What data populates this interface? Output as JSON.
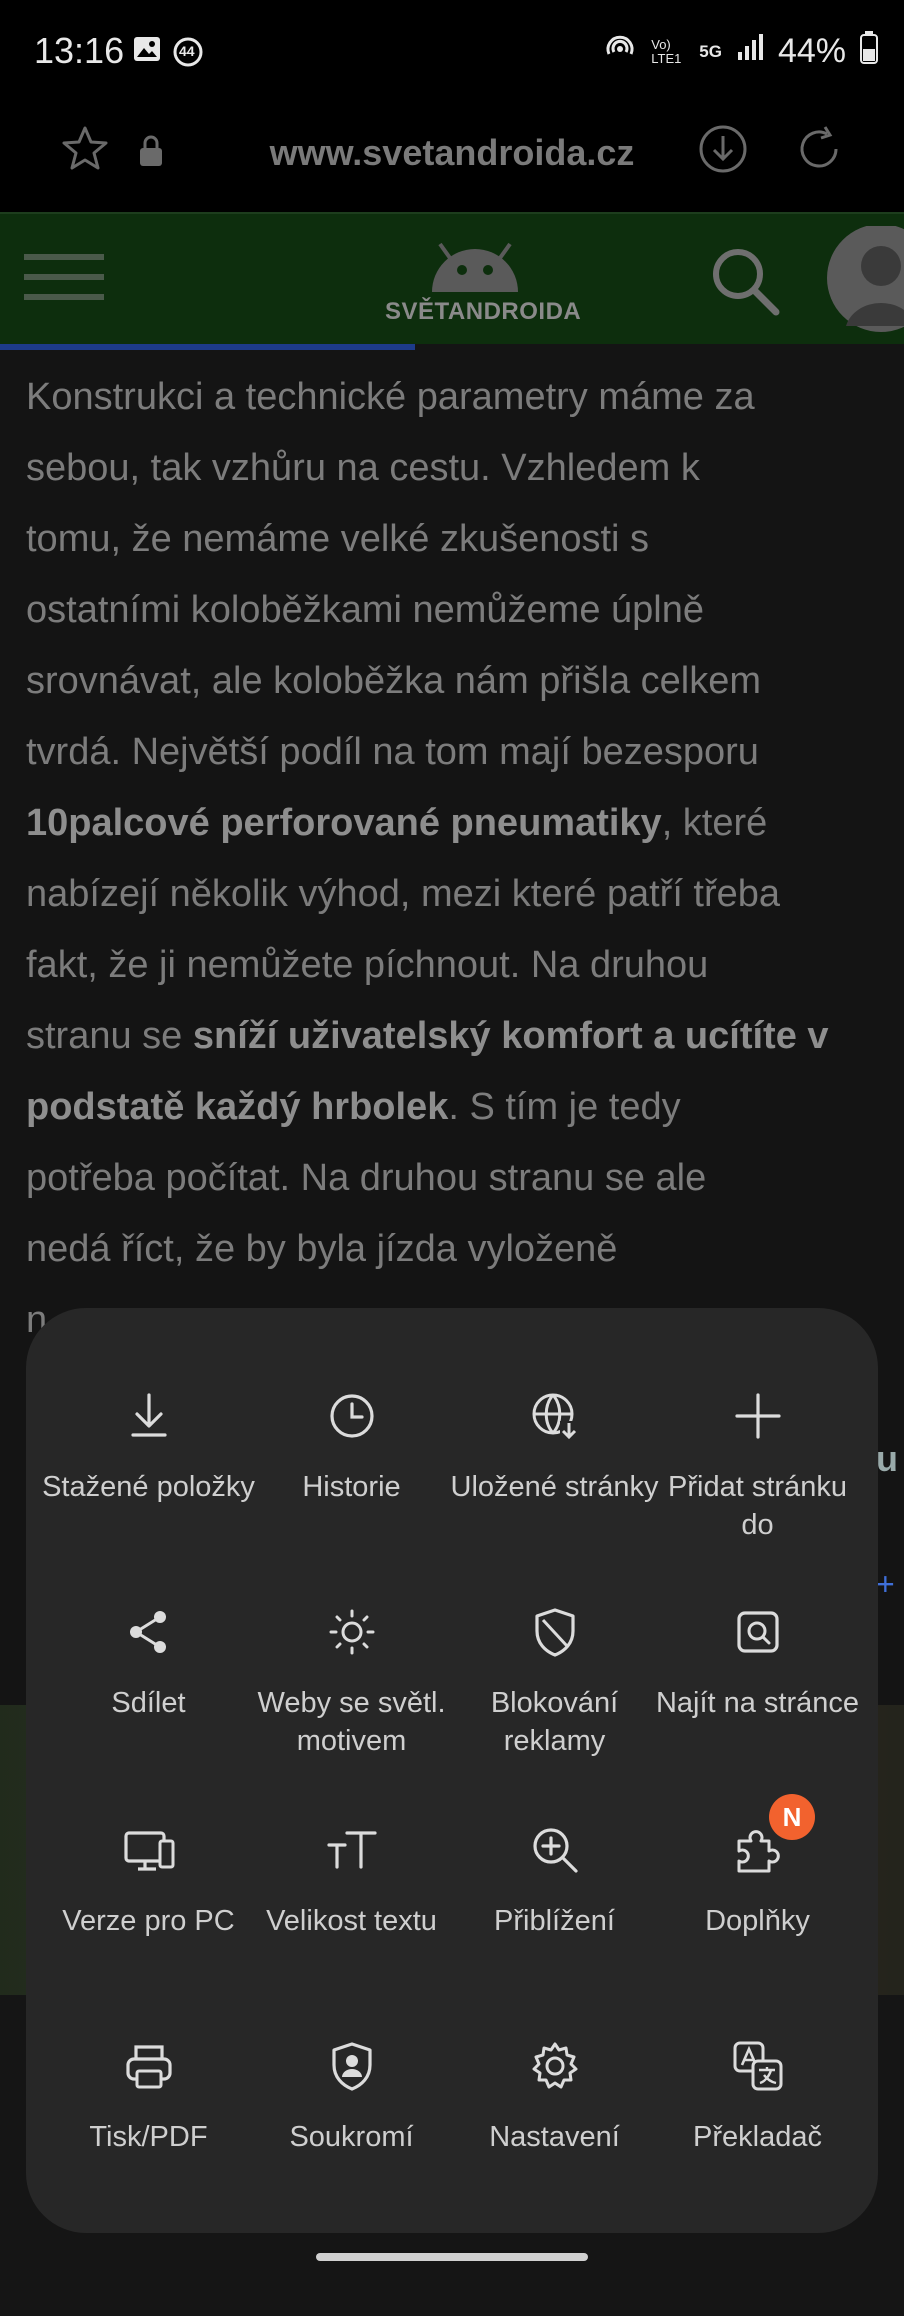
{
  "status_bar": {
    "time": "13:16",
    "notification_count": "44",
    "network": "5G",
    "carrier_label": "Vo) LTE1",
    "battery": "44%"
  },
  "browser": {
    "url": "www.svetandroida.cz"
  },
  "site": {
    "logo_text": "SVĚTANDROIDA"
  },
  "article": {
    "lines": [
      [
        {
          "t": "Konstrukci a technické parametry máme za",
          "b": false
        }
      ],
      [
        {
          "t": "sebou, tak vzhůru na cestu. Vzhledem k",
          "b": false
        }
      ],
      [
        {
          "t": "tomu, že nemáme velké zkušenosti s",
          "b": false
        }
      ],
      [
        {
          "t": "ostatními koloběžkami nemůžeme úplně",
          "b": false
        }
      ],
      [
        {
          "t": "srovnávat, ale koloběžka nám přišla celkem",
          "b": false
        }
      ],
      [
        {
          "t": "tvrdá. Největší podíl na tom mají bezesporu",
          "b": false
        }
      ],
      [
        {
          "t": "10palcové perforované pneumatiky",
          "b": true
        },
        {
          "t": ", které",
          "b": false
        }
      ],
      [
        {
          "t": "nabízejí několik výhod, mezi které patří třeba",
          "b": false
        }
      ],
      [
        {
          "t": "fakt, že ji nemůžete píchnout. Na druhou",
          "b": false
        }
      ],
      [
        {
          "t": "stranu se ",
          "b": false
        },
        {
          "t": "sníží uživatelský komfort a ucítíte v",
          "b": true
        }
      ],
      [
        {
          "t": "podstatě každý hrbolek",
          "b": true
        },
        {
          "t": ". S tím je tedy",
          "b": false
        }
      ],
      [
        {
          "t": "potřeba počítat. Na druhou stranu se ale",
          "b": false
        }
      ],
      [
        {
          "t": "nedá říct, že by byla jízda vyloženě",
          "b": false
        }
      ],
      [
        {
          "t": "n",
          "b": false
        }
      ]
    ],
    "peek_right": "u",
    "peek_plus": "+"
  },
  "menu": {
    "items": [
      {
        "label": "Stažené položky",
        "icon": "download-icon"
      },
      {
        "label": "Historie",
        "icon": "clock-icon"
      },
      {
        "label": "Uložené stránky",
        "icon": "saved-pages-icon"
      },
      {
        "label": "Přidat stránku do",
        "icon": "plus-icon"
      },
      {
        "label": "Sdílet",
        "icon": "share-icon"
      },
      {
        "label": "Weby se světl. motivem",
        "icon": "sun-icon"
      },
      {
        "label": "Blokování reklamy",
        "icon": "shield-icon"
      },
      {
        "label": "Najít na stránce",
        "icon": "find-in-page-icon"
      },
      {
        "label": "Verze pro PC",
        "icon": "desktop-icon"
      },
      {
        "label": "Velikost textu",
        "icon": "text-size-icon"
      },
      {
        "label": "Přiblížení",
        "icon": "zoom-in-icon"
      },
      {
        "label": "Doplňky",
        "icon": "puzzle-icon",
        "badge": "N"
      },
      {
        "label": "Tisk/PDF",
        "icon": "printer-icon"
      },
      {
        "label": "Soukromí",
        "icon": "privacy-shield-icon"
      },
      {
        "label": "Nastavení",
        "icon": "gear-icon"
      },
      {
        "label": "Překladač",
        "icon": "translate-icon"
      }
    ]
  },
  "colors": {
    "menu_bg": "#272727",
    "badge": "#f2622e",
    "site_header_bg": "#0d2e0d",
    "progress": "#1d3b8a"
  }
}
